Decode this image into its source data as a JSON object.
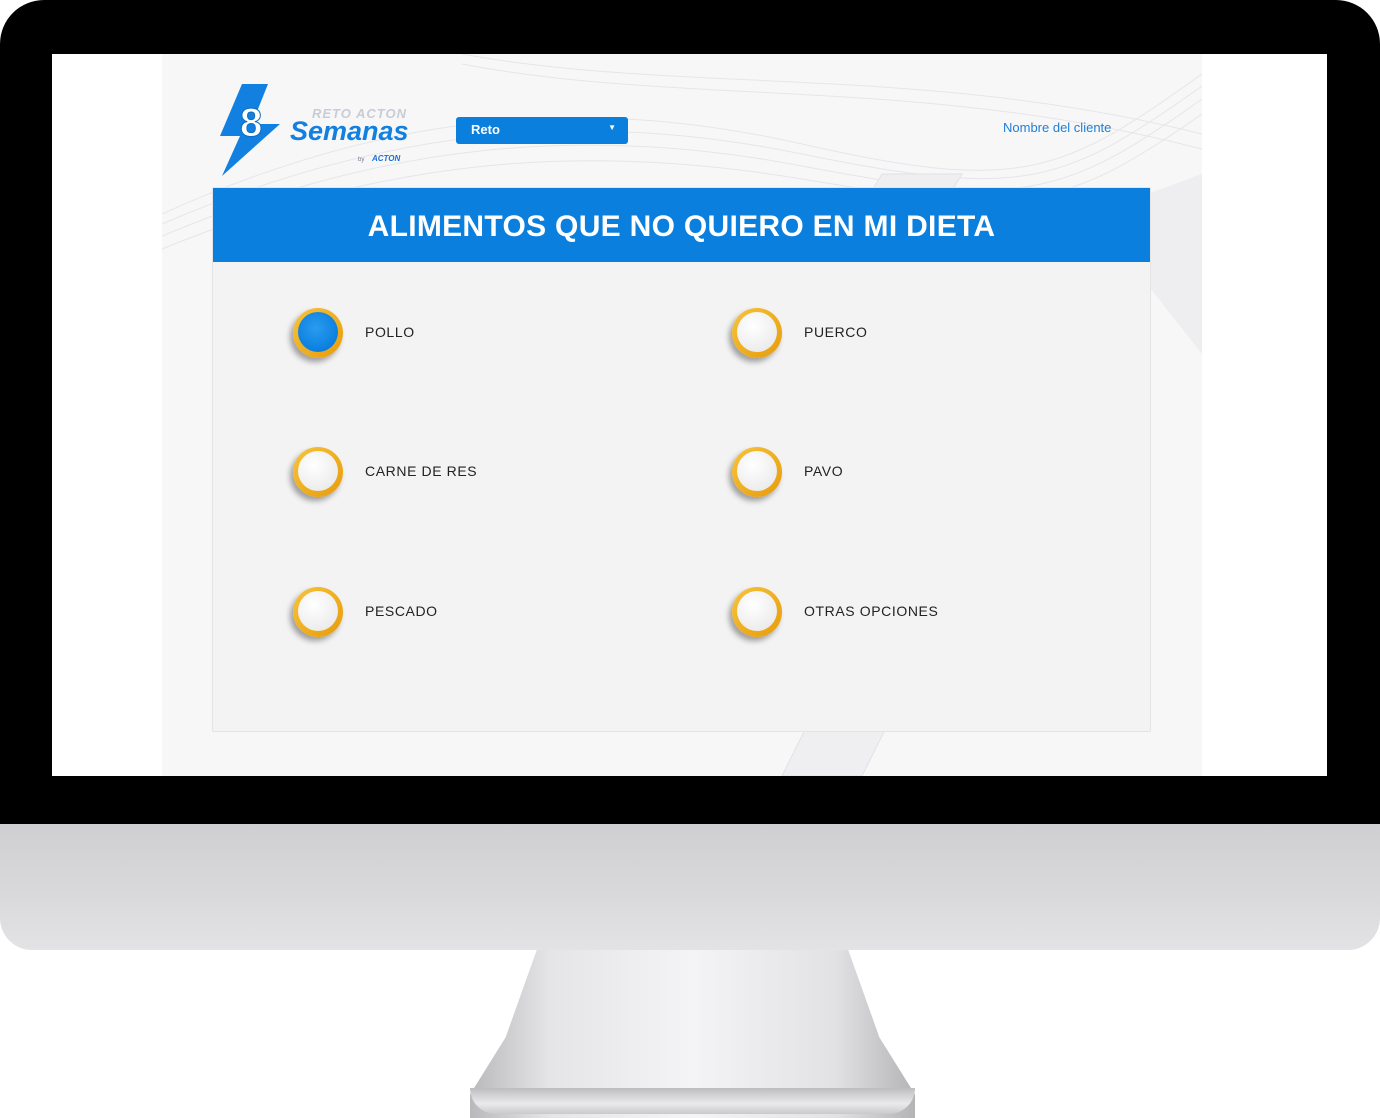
{
  "header": {
    "logo": {
      "number": "8",
      "line1": "RETO ACTON",
      "line2": "Semanas",
      "by": "by",
      "brand": "ACTON"
    },
    "reto_select": {
      "value": "Reto"
    },
    "client_name": "Nombre del cliente"
  },
  "card": {
    "title": "ALIMENTOS QUE NO QUIERO EN MI DIETA",
    "options": [
      {
        "label": "POLLO",
        "checked": true
      },
      {
        "label": "PUERCO",
        "checked": false
      },
      {
        "label": "CARNE DE RES",
        "checked": false
      },
      {
        "label": "PAVO",
        "checked": false
      },
      {
        "label": "PESCADO",
        "checked": false
      },
      {
        "label": "OTRAS OPCIONES",
        "checked": false
      }
    ]
  },
  "colors": {
    "primary": "#0a7fde",
    "radio_ring": "#f2b01e",
    "bezel": "#000000",
    "chin": "#d9d9db"
  }
}
